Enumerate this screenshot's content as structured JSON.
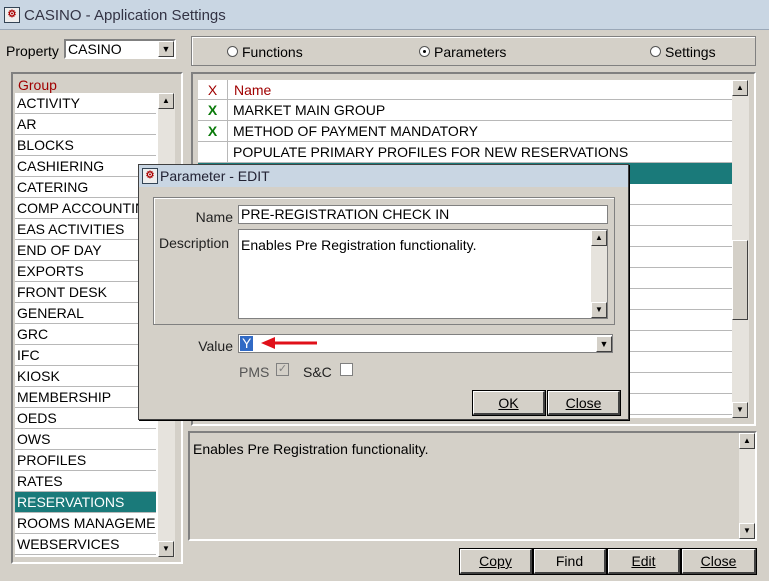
{
  "window": {
    "title": "CASINO - Application Settings"
  },
  "property": {
    "label": "Property",
    "value": "CASINO"
  },
  "mode_radios": [
    {
      "label": "Functions",
      "checked": false
    },
    {
      "label": "Parameters",
      "checked": true
    },
    {
      "label": "Settings",
      "checked": false
    }
  ],
  "group": {
    "header": "Group",
    "items": [
      "ACTIVITY",
      "AR",
      "BLOCKS",
      "CASHIERING",
      "CATERING",
      "COMP ACCOUNTING",
      "EAS ACTIVITIES",
      "END OF DAY",
      "EXPORTS",
      "FRONT DESK",
      "GENERAL",
      "GRC",
      "IFC",
      "KIOSK",
      "MEMBERSHIP",
      "OEDS",
      "OWS",
      "PROFILES",
      "RATES",
      "RESERVATIONS",
      "ROOMS MANAGEMENT",
      "WEBSERVICES"
    ],
    "selected": "RESERVATIONS"
  },
  "params": {
    "col_x": "X",
    "col_name": "Name",
    "rows": [
      {
        "x": "X",
        "name": "MARKET MAIN GROUP"
      },
      {
        "x": "X",
        "name": "METHOD OF PAYMENT MANDATORY"
      },
      {
        "x": "",
        "name": "POPULATE PRIMARY PROFILES FOR NEW RESERVATIONS"
      }
    ]
  },
  "description_panel": {
    "text": "Enables Pre Registration functionality."
  },
  "buttons": {
    "copy": "Copy",
    "find": "Find",
    "edit": "Edit",
    "close": "Close"
  },
  "dialog": {
    "title": "Parameter - EDIT",
    "name_label": "Name",
    "name_value": "PRE-REGISTRATION CHECK IN",
    "desc_label": "Description",
    "desc_value": "Enables Pre Registration functionality.",
    "value_label": "Value",
    "value": "Y",
    "pms_label": "PMS",
    "pms_checked": true,
    "sc_label": "S&C",
    "sc_checked": false,
    "ok_label": "OK",
    "close_label": "Close"
  }
}
